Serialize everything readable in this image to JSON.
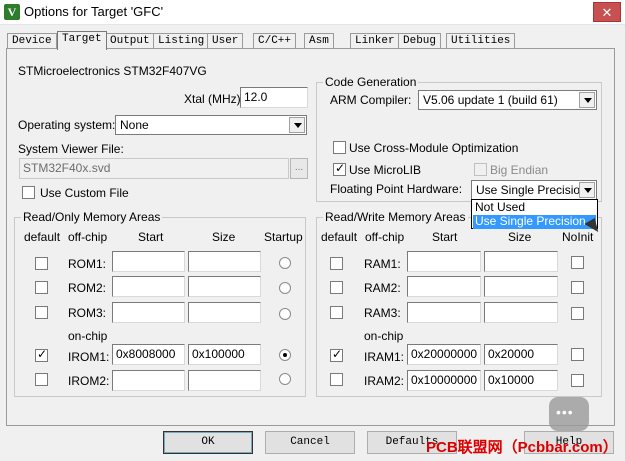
{
  "window": {
    "title": "Options for Target 'GFC'",
    "close_glyph": "✕",
    "app_icon_glyph": "V"
  },
  "tabs": [
    {
      "label": "Device"
    },
    {
      "label": "Target"
    },
    {
      "label": "Output"
    },
    {
      "label": "Listing"
    },
    {
      "label": "User"
    },
    {
      "label": "C/C++"
    },
    {
      "label": "Asm"
    },
    {
      "label": "Linker"
    },
    {
      "label": "Debug"
    },
    {
      "label": "Utilities"
    }
  ],
  "target": {
    "device_name": "STMicroelectronics STM32F407VG",
    "xtal_label": "Xtal (MHz):",
    "xtal_value": "12.0",
    "os_label": "Operating system:",
    "os_value": "None",
    "svd_label": "System Viewer File:",
    "svd_value": "STM32F40x.svd",
    "browse_label": "...",
    "custom_file_label": "Use Custom File",
    "custom_file_checked": false
  },
  "codegen": {
    "title": "Code Generation",
    "compiler_label": "ARM Compiler:",
    "compiler_value": "V5.06 update 1 (build 61)",
    "cross_module_label": "Use Cross-Module Optimization",
    "microlib_label": "Use MicroLIB",
    "big_endian_label": "Big Endian",
    "fp_label": "Floating Point Hardware:",
    "fp_value": "Use Single Precision",
    "fp_options": [
      "Not Used",
      "Use Single Precision"
    ],
    "fp_selected": "Use Single Precision"
  },
  "ro_memory": {
    "title": "Read/Only Memory Areas",
    "headers": {
      "default": "default",
      "offchip": "off-chip",
      "start": "Start",
      "size": "Size",
      "startup": "Startup"
    },
    "onchip_label": "on-chip",
    "rows": [
      {
        "name": "ROM1:",
        "start": "",
        "size": "",
        "default": false,
        "startup": false
      },
      {
        "name": "ROM2:",
        "start": "",
        "size": "",
        "default": false,
        "startup": false
      },
      {
        "name": "ROM3:",
        "start": "",
        "size": "",
        "default": false,
        "startup": false
      },
      {
        "name": "IROM1:",
        "start": "0x8008000",
        "size": "0x100000",
        "default": true,
        "startup": true
      },
      {
        "name": "IROM2:",
        "start": "",
        "size": "",
        "default": false,
        "startup": false
      }
    ]
  },
  "rw_memory": {
    "title": "Read/Write Memory Areas",
    "headers": {
      "default": "default",
      "offchip": "off-chip",
      "start": "Start",
      "size": "Size",
      "noinit": "NoInit"
    },
    "onchip_label": "on-chip",
    "rows": [
      {
        "name": "RAM1:",
        "start": "",
        "size": "",
        "default": false,
        "noinit": false
      },
      {
        "name": "RAM2:",
        "start": "",
        "size": "",
        "default": false,
        "noinit": false
      },
      {
        "name": "RAM3:",
        "start": "",
        "size": "",
        "default": false,
        "noinit": false
      },
      {
        "name": "IRAM1:",
        "start": "0x20000000",
        "size": "0x20000",
        "default": true,
        "noinit": false
      },
      {
        "name": "IRAM2:",
        "start": "0x10000000",
        "size": "0x10000",
        "default": false,
        "noinit": false
      }
    ]
  },
  "buttons": {
    "ok": "OK",
    "cancel": "Cancel",
    "defaults": "Defaults",
    "help": "Help"
  },
  "watermark": {
    "text": "PCB联盟网（Pcbbar.com）"
  },
  "colors": {
    "selection": "#3399ff",
    "close": "#c75050",
    "watermark": "#dd0000"
  }
}
